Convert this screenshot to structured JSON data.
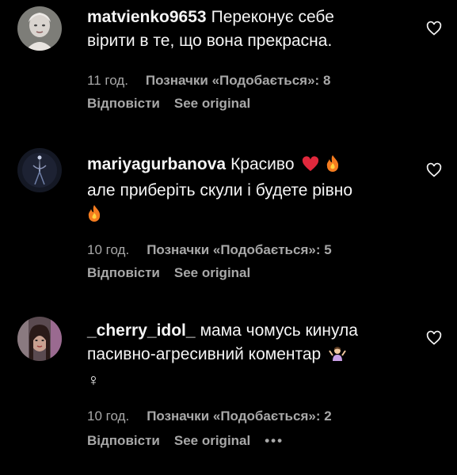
{
  "colors": {
    "background": "#000000",
    "text": "#f5f5f5",
    "meta": "#a8a8a8"
  },
  "comments": [
    {
      "username": "matvienko9653",
      "text_line1": "Переконує себе",
      "text_line2": "вірити в те, що вона прекрасна.",
      "time": "11 год.",
      "likes": "Позначки «Подобається»: 8",
      "reply": "Відповісти",
      "see_original": "See original",
      "avatar_icon": "avatar-photo",
      "like_icon": "heart-outline-icon"
    },
    {
      "username": "mariyagurbanova",
      "text_line1": "Красиво",
      "text_line2": "але приберіть скули і будете рівно",
      "emoji": [
        "red-heart-emoji",
        "fire-emoji",
        "fire-emoji"
      ],
      "time": "10 год.",
      "likes": "Позначки «Подобається»: 5",
      "reply": "Відповісти",
      "see_original": "See original",
      "avatar_icon": "avatar-photo",
      "like_icon": "heart-outline-icon"
    },
    {
      "username": "_cherry_idol_",
      "text_line1": "мама чомусь кинула",
      "text_line2": "пасивно-агресивний коментар",
      "text_line3": "♀",
      "emoji": [
        "person-shrugging-emoji"
      ],
      "time": "10 год.",
      "likes": "Позначки «Подобається»: 2",
      "reply": "Відповісти",
      "see_original": "See original",
      "more": "•••",
      "avatar_icon": "avatar-photo",
      "like_icon": "heart-outline-icon"
    }
  ]
}
